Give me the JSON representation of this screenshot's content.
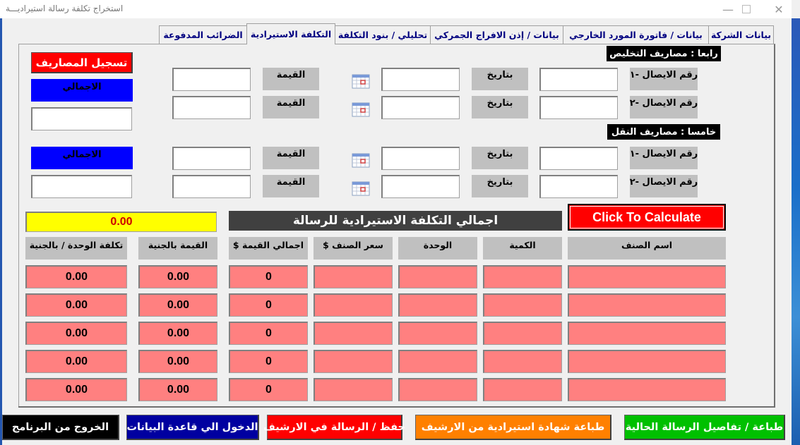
{
  "window": {
    "title": "استخراج تكلفة رسالة استيراديـــة",
    "minimize_icon": "minimize-icon",
    "maximize_icon": "maximize-icon",
    "close_icon": "close-icon"
  },
  "tabs": [
    {
      "label": "بيانات الشركة",
      "active": false
    },
    {
      "label": "بيانات / فاتورة المورد الخارجي",
      "active": false
    },
    {
      "label": "بيانات / إذن الافراج الجمركي",
      "active": false
    },
    {
      "label": "تحليلي / بنود التكلفة",
      "active": false
    },
    {
      "label": "التكلفة الاستيرادية",
      "active": true
    },
    {
      "label": "الضرائب المدفوعة",
      "active": false
    }
  ],
  "clearance": {
    "heading": "رابعا : مصاريف التخليص",
    "rows": [
      {
        "receipt_label": "رقم الايصال -١",
        "receipt_value": "",
        "date_label": "بتاريخ",
        "date_value": "",
        "calendar_icon": "calendar-icon",
        "value_label": "القيمة",
        "value": ""
      },
      {
        "receipt_label": "رقم الايصال -٢",
        "receipt_value": "",
        "date_label": "بتاريخ",
        "date_value": "",
        "calendar_icon": "calendar-icon",
        "value_label": "القيمة",
        "value": ""
      }
    ],
    "total_label": "الاجمالي",
    "total_value": ""
  },
  "transport": {
    "heading": "خامسا : مصاريف النقل",
    "rows": [
      {
        "receipt_label": "رقم الايصال -١",
        "receipt_value": "",
        "date_label": "بتاريخ",
        "date_value": "",
        "calendar_icon": "calendar-icon",
        "value_label": "القيمة",
        "value": ""
      },
      {
        "receipt_label": "رقم الايصال -٢",
        "receipt_value": "",
        "date_label": "بتاريخ",
        "date_value": "",
        "calendar_icon": "calendar-icon",
        "value_label": "القيمة",
        "value": ""
      }
    ],
    "total_label": "الاجمالي",
    "total_value": ""
  },
  "register_expenses_button": "تسجيل المصاريف",
  "total_cost": {
    "title": "اجمالي التكلفة الاستيرادية للرسالة",
    "value": "0.00",
    "calculate_button": "Click To Calculate"
  },
  "items_table": {
    "columns": [
      "اسم الصنف",
      "الكمية",
      "الوحدة",
      "سعر الصنف $",
      "اجمالي القيمة $",
      "القيمة بالجنية",
      "تكلفة الوحدة / بالجنية"
    ],
    "rows": [
      [
        "",
        "",
        "",
        "",
        "0",
        "0.00",
        "0.00"
      ],
      [
        "",
        "",
        "",
        "",
        "0",
        "0.00",
        "0.00"
      ],
      [
        "",
        "",
        "",
        "",
        "0",
        "0.00",
        "0.00"
      ],
      [
        "",
        "",
        "",
        "",
        "0",
        "0.00",
        "0.00"
      ],
      [
        "",
        "",
        "",
        "",
        "0",
        "0.00",
        "0.00"
      ]
    ]
  },
  "bottom_buttons": {
    "print_current": "طباعة / تفاصيل الرسالة الحالية",
    "print_certificate": "طباعة شهادة استيرادية من الارشيف",
    "save_archive": "حفظ / الرسالة في الارشيف",
    "enter_database": "الدخول الي قاعدة البيانات",
    "exit_program": "الخروج من البرنامج"
  },
  "colors": {
    "red": "#ff0000",
    "blue": "#0000ff",
    "yellow": "#ffff00",
    "cell_pink": "#ff8080",
    "green": "#00c000",
    "orange": "#ff8000",
    "navy": "#0000a0",
    "tab_text": "#000080"
  }
}
